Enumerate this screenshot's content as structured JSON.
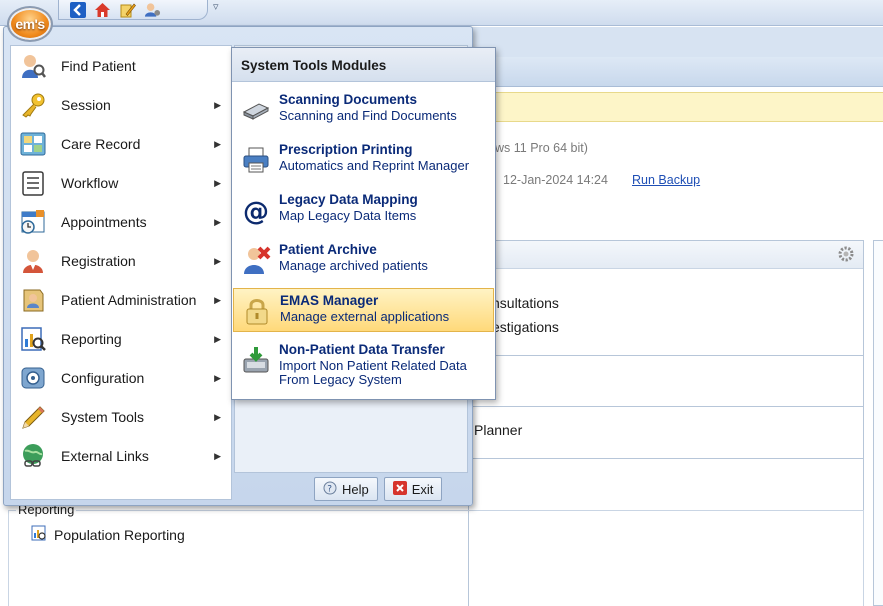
{
  "app": {
    "logo_text": "em's",
    "quick_access": [
      "back-icon",
      "home-icon",
      "edit-icon",
      "user-settings-icon"
    ]
  },
  "background": {
    "os_info": "ws 11 Pro 64 bit)",
    "backup_date": "12-Jan-2024 14:24",
    "backup_link": "Run Backup",
    "list_items": [
      "nsultations",
      "estigations",
      "Planner"
    ],
    "reporting_group": "Reporting",
    "population_reporting": "Population Reporting"
  },
  "menu": {
    "items": [
      {
        "label": "Find Patient",
        "icon": "find-patient-icon",
        "arrow": false
      },
      {
        "label": "Session",
        "icon": "key-icon",
        "arrow": true
      },
      {
        "label": "Care Record",
        "icon": "care-record-icon",
        "arrow": true
      },
      {
        "label": "Workflow",
        "icon": "workflow-icon",
        "arrow": true
      },
      {
        "label": "Appointments",
        "icon": "appointments-icon",
        "arrow": true
      },
      {
        "label": "Registration",
        "icon": "registration-icon",
        "arrow": true
      },
      {
        "label": "Patient Administration",
        "icon": "patient-admin-icon",
        "arrow": true
      },
      {
        "label": "Reporting",
        "icon": "reporting-icon",
        "arrow": true
      },
      {
        "label": "Configuration",
        "icon": "configuration-icon",
        "arrow": true
      },
      {
        "label": "System Tools",
        "icon": "pencil-icon",
        "arrow": true
      },
      {
        "label": "External Links",
        "icon": "globe-icon",
        "arrow": true
      }
    ],
    "help_label": "Help",
    "exit_label": "Exit"
  },
  "submenu": {
    "title": "System Tools Modules",
    "items": [
      {
        "title": "Scanning  Documents",
        "desc": "Scanning and Find Documents",
        "icon": "scanner-icon",
        "highlighted": false
      },
      {
        "title": "Prescription Printing",
        "desc": "Automatics and Reprint Manager",
        "icon": "printer-icon",
        "highlighted": false
      },
      {
        "title": "Legacy Data Mapping",
        "desc": "Map Legacy Data Items",
        "icon": "at-sign-icon",
        "highlighted": false
      },
      {
        "title": "Patient Archive",
        "desc": "Manage archived patients",
        "icon": "patient-archive-icon",
        "highlighted": false
      },
      {
        "title": "EMAS Manager",
        "desc": "Manage external applications",
        "icon": "lock-icon",
        "highlighted": true
      },
      {
        "title": "Non-Patient Data Transfer",
        "desc": "Import Non Patient Related Data",
        "desc2": "From Legacy System",
        "icon": "data-transfer-icon",
        "highlighted": false
      }
    ]
  }
}
